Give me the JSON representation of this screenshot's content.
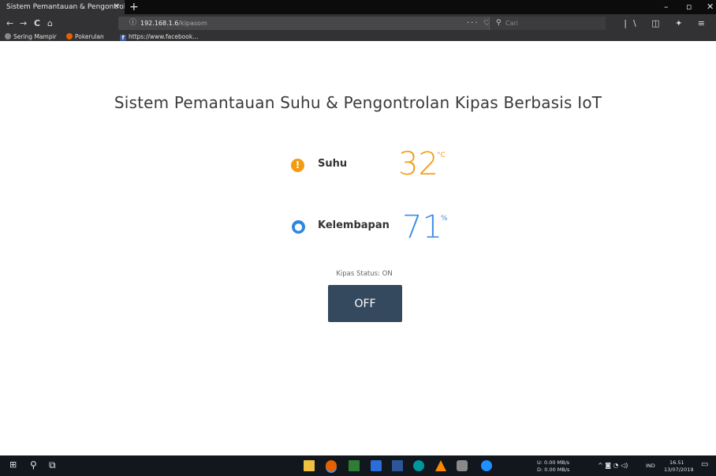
{
  "browser": {
    "tab_title": "Sistem Pemantauan & Pengontrol",
    "tab_close": "✕",
    "new_tab": "+",
    "window_controls": {
      "minimize": "–",
      "restore": "▫",
      "close": "✕"
    },
    "nav": {
      "back": "←",
      "forward": "→",
      "reload": "C",
      "home": "⌂"
    },
    "url_host": "192.168.1.6",
    "url_path": "/kipasom",
    "page_actions": "··· ♡ ☆",
    "search_placeholder": "Cari",
    "toolbar_right": "|\\ ◫ ✦ ≡",
    "bookmarks": [
      {
        "label": "Sering Mampir",
        "icon": "gear-icon"
      },
      {
        "label": "Pokerulan",
        "icon": "firefox-icon"
      },
      {
        "label": "https://www.facebook...",
        "icon": "facebook-icon"
      }
    ]
  },
  "page": {
    "title": "Sistem Pemantauan Suhu & Pengontrolan Kipas Berbasis IoT",
    "temperature": {
      "label": "Suhu",
      "value": "32",
      "unit": "°C",
      "icon": "thermometer-icon"
    },
    "humidity": {
      "label": "Kelembapan",
      "value": "71",
      "unit": "%",
      "icon": "droplet-icon"
    },
    "fan_status": "Kipas Status: ON",
    "toggle_button": "OFF"
  },
  "taskbar": {
    "network_up": "U:    0.00 MB/s",
    "network_down": "D:    0.00 MB/s",
    "language": "IND",
    "time": "16.51",
    "date": "13/07/2019",
    "tray_icons": "^ ◙ ◔ ◁)"
  },
  "colors": {
    "accent_temperature": "#f39c12",
    "accent_humidity": "#3a8ee6",
    "button_bg": "#34495e"
  }
}
